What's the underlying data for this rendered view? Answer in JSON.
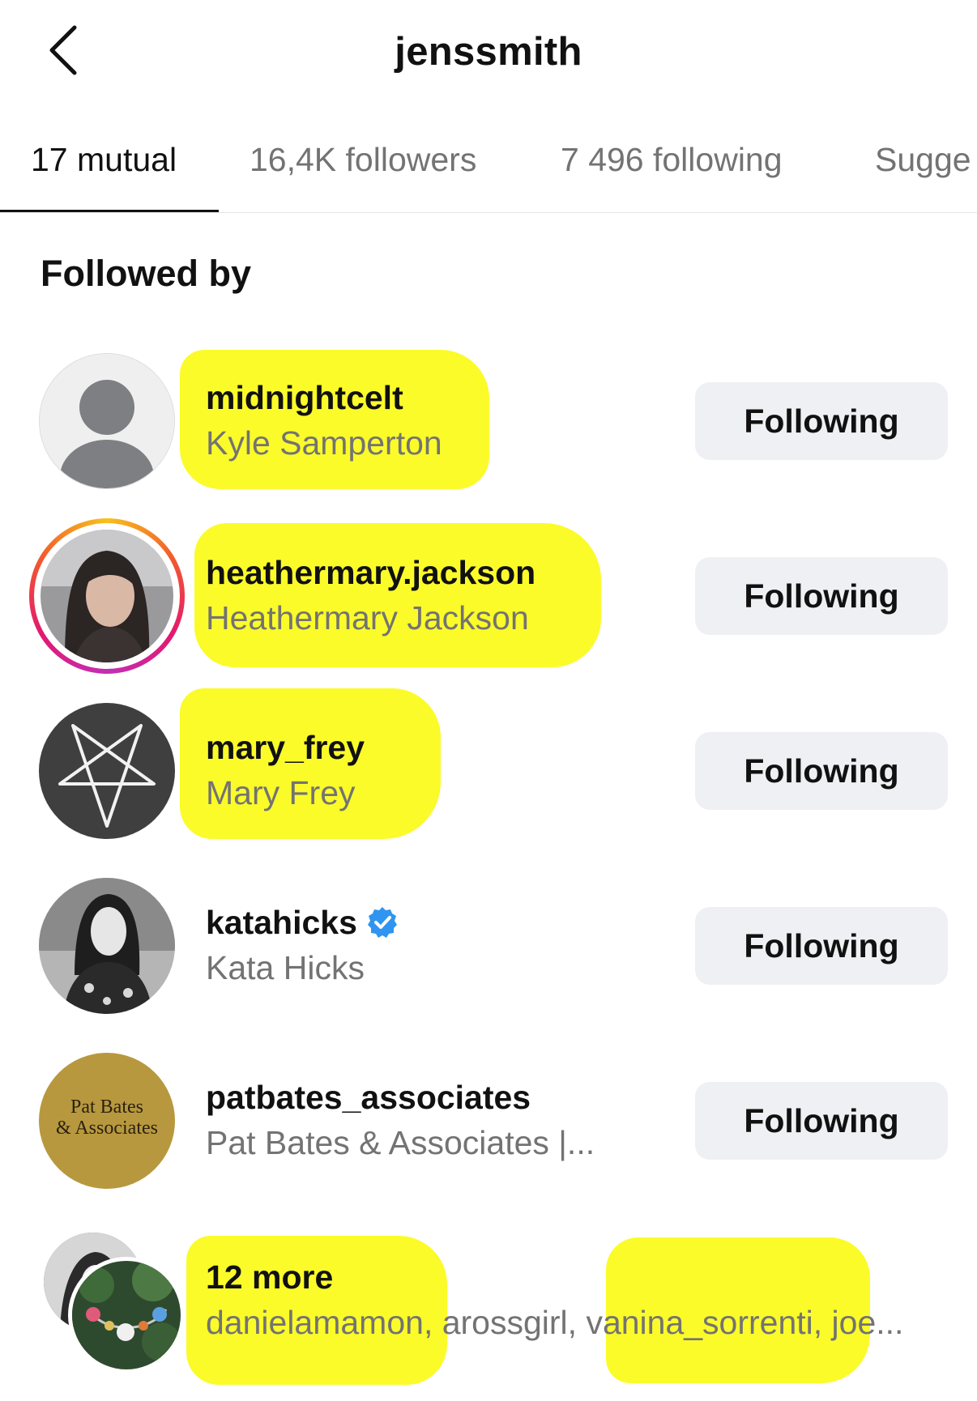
{
  "header": {
    "title": "jenssmith",
    "back_icon": "chevron-left-icon"
  },
  "tabs": [
    {
      "label": "17 mutual",
      "active": true
    },
    {
      "label": "16,4K followers",
      "active": false
    },
    {
      "label": "7 496 following",
      "active": false
    },
    {
      "label": "Sugge",
      "active": false
    }
  ],
  "section": {
    "title": "Followed by"
  },
  "users": [
    {
      "username": "midnightcelt",
      "full_name": "Kyle Samperton",
      "button": "Following",
      "highlighted": true,
      "avatar": "default-avatar-icon"
    },
    {
      "username": "heathermary.jackson",
      "full_name": "Heathermary Jackson",
      "button": "Following",
      "highlighted": true,
      "avatar": "photo",
      "story_ring": true
    },
    {
      "username": "mary_frey",
      "full_name": "Mary Frey",
      "button": "Following",
      "highlighted": true,
      "avatar": "pentagram-icon"
    },
    {
      "username": "katahicks",
      "full_name": "Kata Hicks",
      "button": "Following",
      "highlighted": false,
      "avatar": "photo",
      "verified": true
    },
    {
      "username": "patbates_associates",
      "full_name": "Pat Bates & Associates |...",
      "button": "Following",
      "highlighted": false,
      "avatar": "logo",
      "avatar_text_1": "Pat Bates",
      "avatar_text_2": "& Associates"
    }
  ],
  "more": {
    "label": "12 more",
    "names": "danielamamon, arossgirl, vanina_sorrenti, joe..."
  },
  "colors": {
    "highlight": "#fbfb2a",
    "button_bg": "#eff0f3",
    "secondary_text": "#737373",
    "verified_blue": "#2f95f0",
    "logo_gold": "#b8983f"
  }
}
